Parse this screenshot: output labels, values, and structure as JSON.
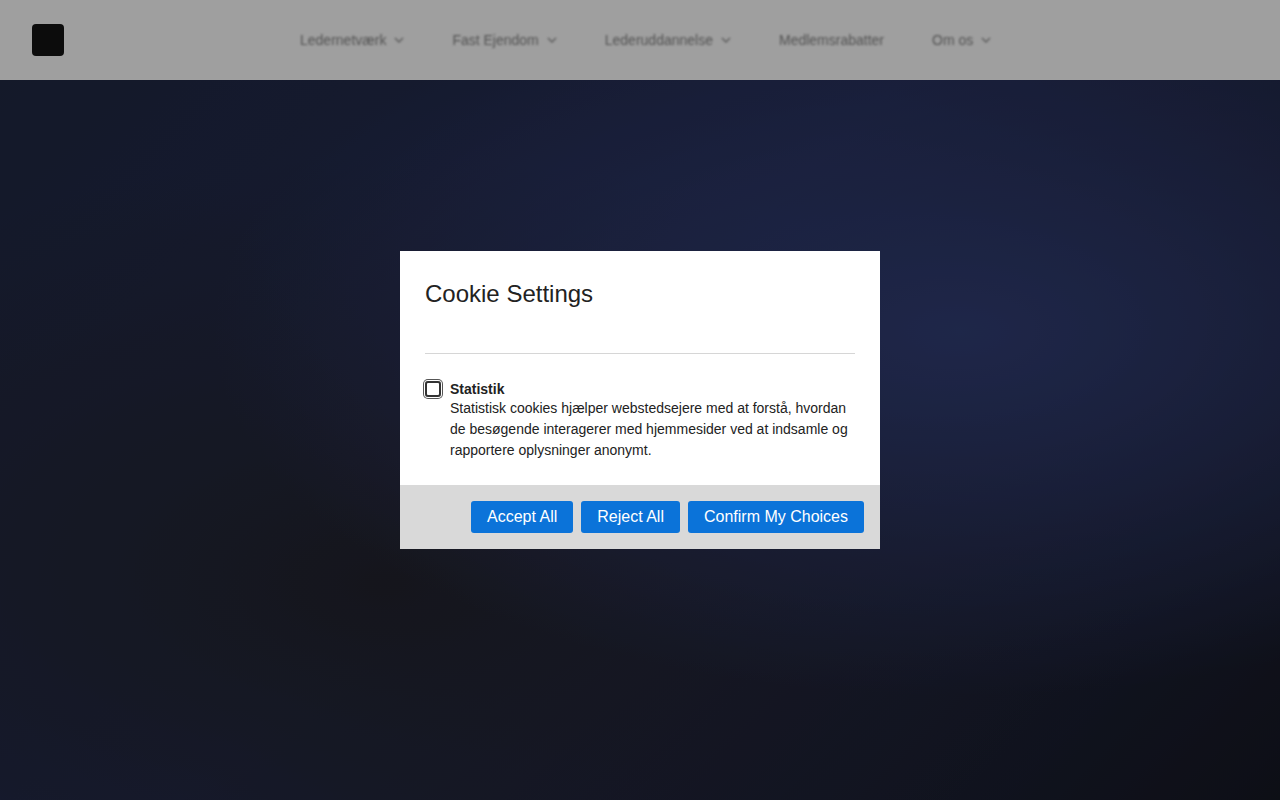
{
  "nav": [
    {
      "label": "Ledernetværk",
      "dropdown": true
    },
    {
      "label": "Fast Ejendom",
      "dropdown": true
    },
    {
      "label": "Lederuddannelse",
      "dropdown": true
    },
    {
      "label": "Medlemsrabatter",
      "dropdown": false
    },
    {
      "label": "Om os",
      "dropdown": true
    }
  ],
  "modal": {
    "title": "Cookie Settings",
    "options": [
      {
        "label": "Statistik",
        "description": "Statistisk cookies hjælper webstedsejere med at forstå, hvordan de besøgende interagerer med hjemmesider ved at indsamle og rapportere oplysninger anonymt.",
        "checked": false
      }
    ],
    "buttons": [
      "Accept All",
      "Reject All",
      "Confirm My Choices"
    ]
  }
}
